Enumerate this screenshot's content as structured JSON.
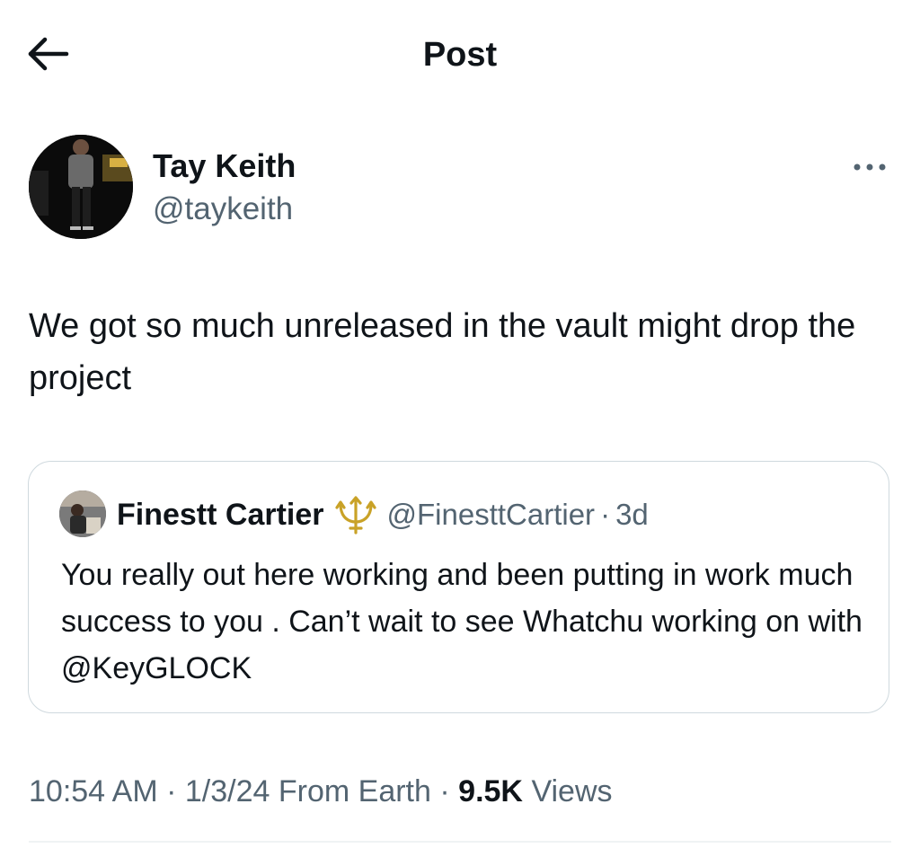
{
  "header": {
    "title": "Post",
    "back_icon": "arrow-left-icon"
  },
  "post": {
    "author": {
      "name": "Tay Keith",
      "handle": "@taykeith"
    },
    "more_icon": "more-horizontal-icon",
    "text": "We got so much unreleased in the vault might drop the project",
    "quote": {
      "name": "Finestt Cartier",
      "emoji_icon": "trident-icon",
      "handle": "@FinesttCartier",
      "separator": "·",
      "time": "3d",
      "text": "You really out here working and been putting in work much success to you . Can’t wait to see Whatchu working on with @KeyGLOCK"
    },
    "meta": {
      "time": "10:54 AM",
      "sep1": "·",
      "date": "1/3/24",
      "source": "From Earth",
      "sep2": "·",
      "views_count": "9.5K",
      "views_label": "Views"
    }
  },
  "colors": {
    "text": "#0f1419",
    "secondary": "#536471",
    "border": "#cfd9de",
    "divider": "#eff3f4",
    "trident": "#c9a227"
  }
}
